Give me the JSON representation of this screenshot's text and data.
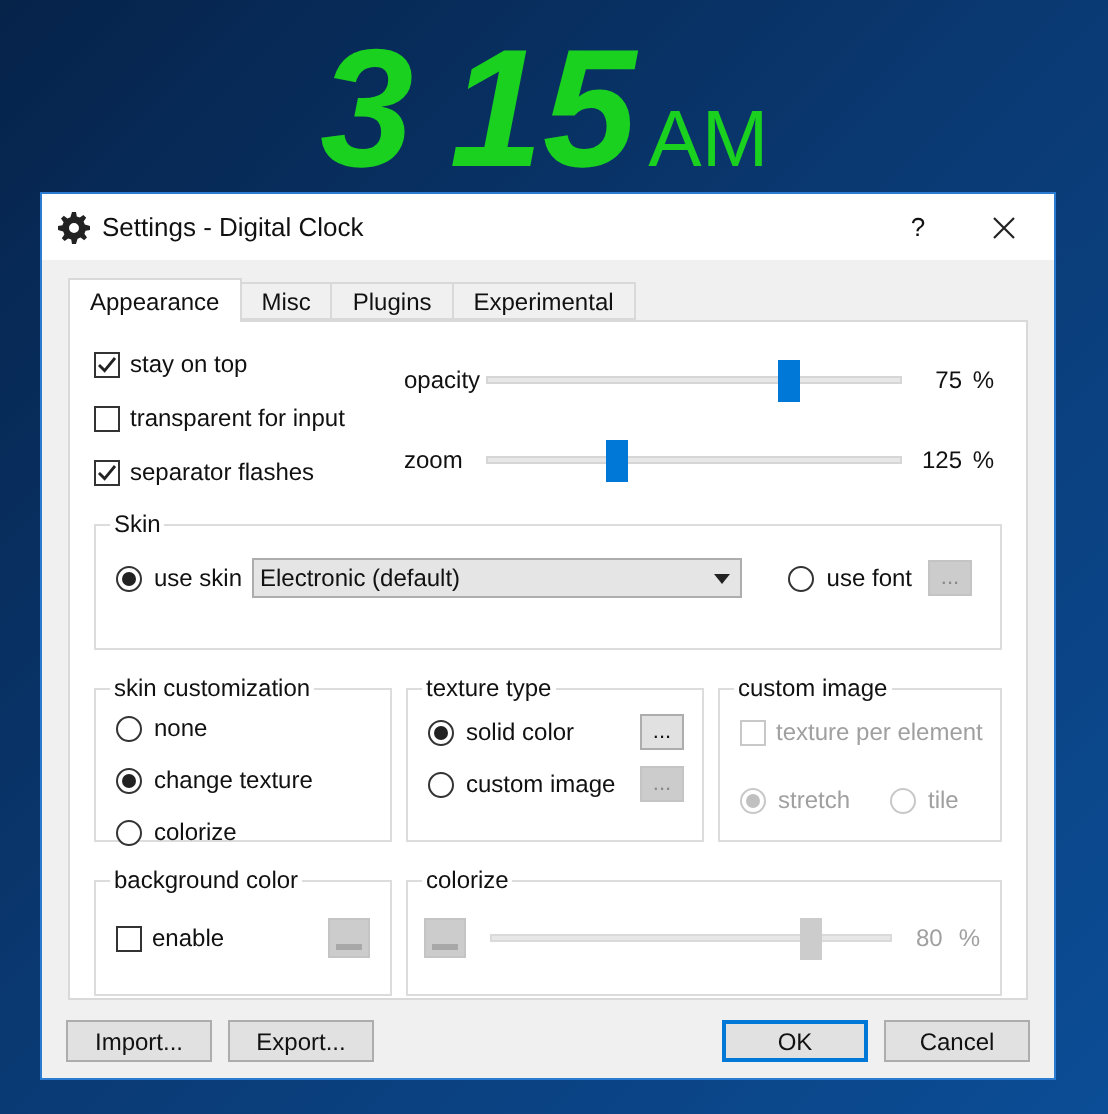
{
  "clock": {
    "hours": "3",
    "minutes": "15",
    "period": "AM"
  },
  "window": {
    "title": "Settings - Digital Clock",
    "help": "?"
  },
  "tabs": [
    {
      "label": "Appearance",
      "selected": true
    },
    {
      "label": "Misc",
      "selected": false
    },
    {
      "label": "Plugins",
      "selected": false
    },
    {
      "label": "Experimental",
      "selected": false
    }
  ],
  "options": [
    {
      "label": "stay on top",
      "checked": true
    },
    {
      "label": "transparent for input",
      "checked": false
    },
    {
      "label": "separator flashes",
      "checked": true
    }
  ],
  "sliders": [
    {
      "label": "opacity",
      "level": 0.73,
      "reading": "75",
      "unit": "%"
    },
    {
      "label": "zoom",
      "level": 0.31,
      "reading": "125",
      "unit": "%"
    }
  ],
  "skin": {
    "title": "Skin",
    "use_skin": {
      "label": "use skin",
      "selected": true
    },
    "dropdown": "Electronic (default)",
    "use_font": {
      "label": "use font",
      "selected": false
    },
    "font_button": {
      "label": "...",
      "disabled": true
    }
  },
  "skin_customization": {
    "title": "skin customization",
    "options": [
      {
        "label": "none",
        "selected": false
      },
      {
        "label": "change texture",
        "selected": true
      },
      {
        "label": "colorize",
        "selected": false
      }
    ]
  },
  "texture_type": {
    "title": "texture type",
    "options": [
      {
        "label": "solid color",
        "selected": true,
        "button": "...",
        "button_disabled": false
      },
      {
        "label": "custom image",
        "selected": false,
        "button": "...",
        "button_disabled": true
      }
    ]
  },
  "custom_image": {
    "title": "custom image",
    "disabled": true,
    "texture_per_element": {
      "label": "texture per element",
      "checked": false
    },
    "modes": [
      {
        "label": "stretch",
        "selected": true
      },
      {
        "label": "tile",
        "selected": false
      }
    ]
  },
  "background_color": {
    "title": "background color",
    "enable": {
      "label": "enable",
      "checked": false
    },
    "color_button_disabled": true
  },
  "colorize": {
    "title": "colorize",
    "disabled": true,
    "level": 0.8,
    "reading": "80",
    "unit": "%"
  },
  "buttons": [
    {
      "label": "Import...",
      "default": false
    },
    {
      "label": "Export...",
      "default": false
    },
    {
      "label": "OK",
      "default": true
    },
    {
      "label": "Cancel",
      "default": false
    }
  ]
}
